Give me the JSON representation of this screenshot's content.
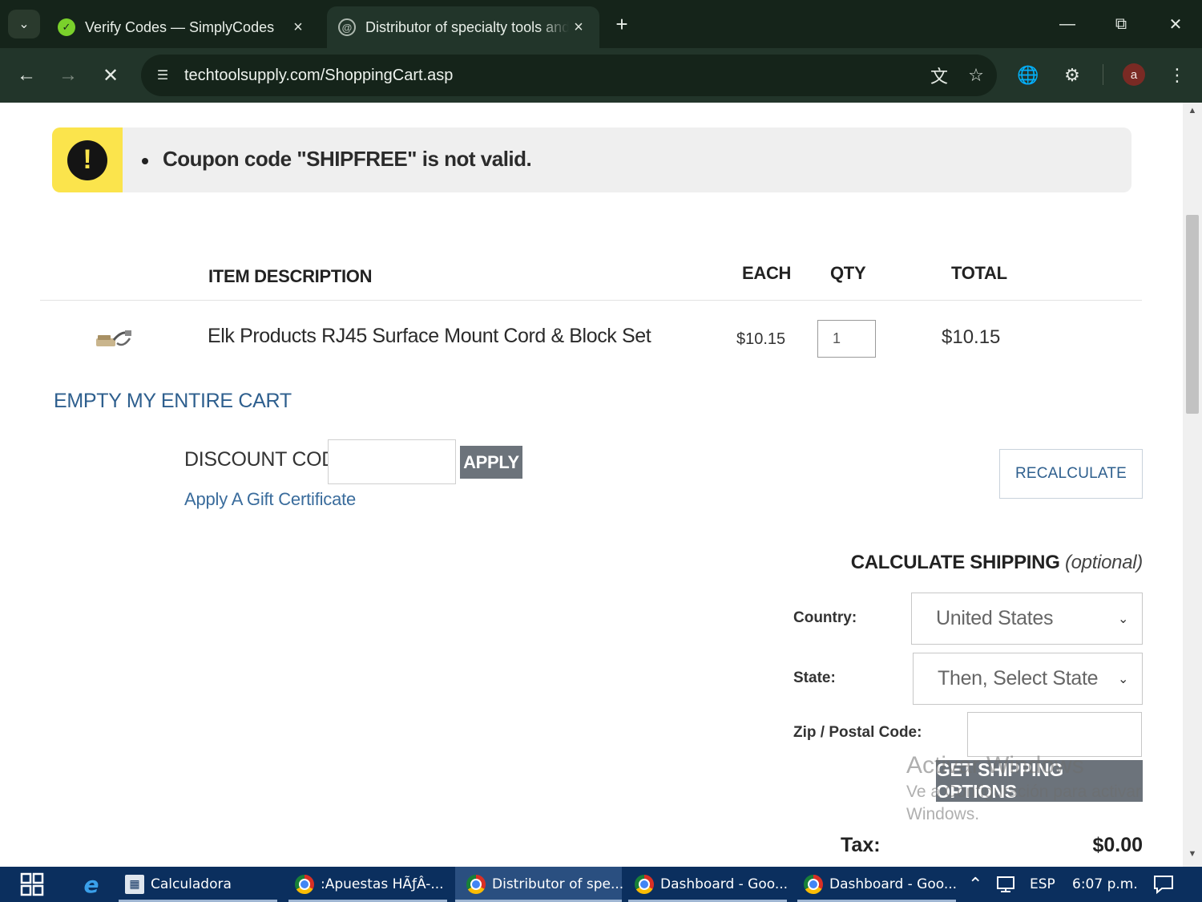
{
  "browser": {
    "tabs": [
      {
        "title": "Verify Codes — SimplyCodes",
        "active": false
      },
      {
        "title": "Distributor of specialty tools and",
        "active": true
      }
    ],
    "url": "techtoolsupply.com/ShoppingCart.asp",
    "profile_initial": "a"
  },
  "alert": {
    "message": "Coupon code \"SHIPFREE\" is not valid."
  },
  "cart": {
    "headers": {
      "description": "ITEM DESCRIPTION",
      "each": "EACH",
      "qty": "QTY",
      "total": "TOTAL"
    },
    "items": [
      {
        "description": "Elk Products RJ45 Surface Mount Cord & Block Set",
        "each": "$10.15",
        "qty": "1",
        "total": "$10.15"
      }
    ],
    "empty_cart_label": "EMPTY MY ENTIRE CART",
    "discount_label": "DISCOUNT CODE",
    "discount_value": "",
    "apply_label": "APPLY",
    "gift_certificate_label": "Apply A Gift Certificate",
    "recalculate_label": "RECALCULATE"
  },
  "shipping": {
    "heading": "CALCULATE SHIPPING",
    "heading_note": "(optional)",
    "country_label": "Country:",
    "country_value": "United States",
    "state_label": "State:",
    "state_value": "Then, Select State",
    "zip_label": "Zip / Postal Code:",
    "zip_value": "",
    "button_label": "GET SHIPPING OPTIONS",
    "tax_label": "Tax:",
    "tax_value": "$0.00"
  },
  "watermark": {
    "line1": "Activar Windows",
    "line2": "Ve a Configuración para activar",
    "line3": "Windows."
  },
  "taskbar": {
    "items": [
      {
        "label": "Calculadora"
      },
      {
        "label": ":Apuestas HÃƒÂ-..."
      },
      {
        "label": "Distributor of spe..."
      },
      {
        "label": "Dashboard - Goo..."
      },
      {
        "label": "Dashboard - Goo..."
      }
    ],
    "language": "ESP",
    "time": "6:07 p.m."
  },
  "colors": {
    "alert_accent": "#fbe44c",
    "link": "#2e5f8e",
    "button_gray": "#6c737b",
    "taskbar": "#0b2f5e"
  }
}
